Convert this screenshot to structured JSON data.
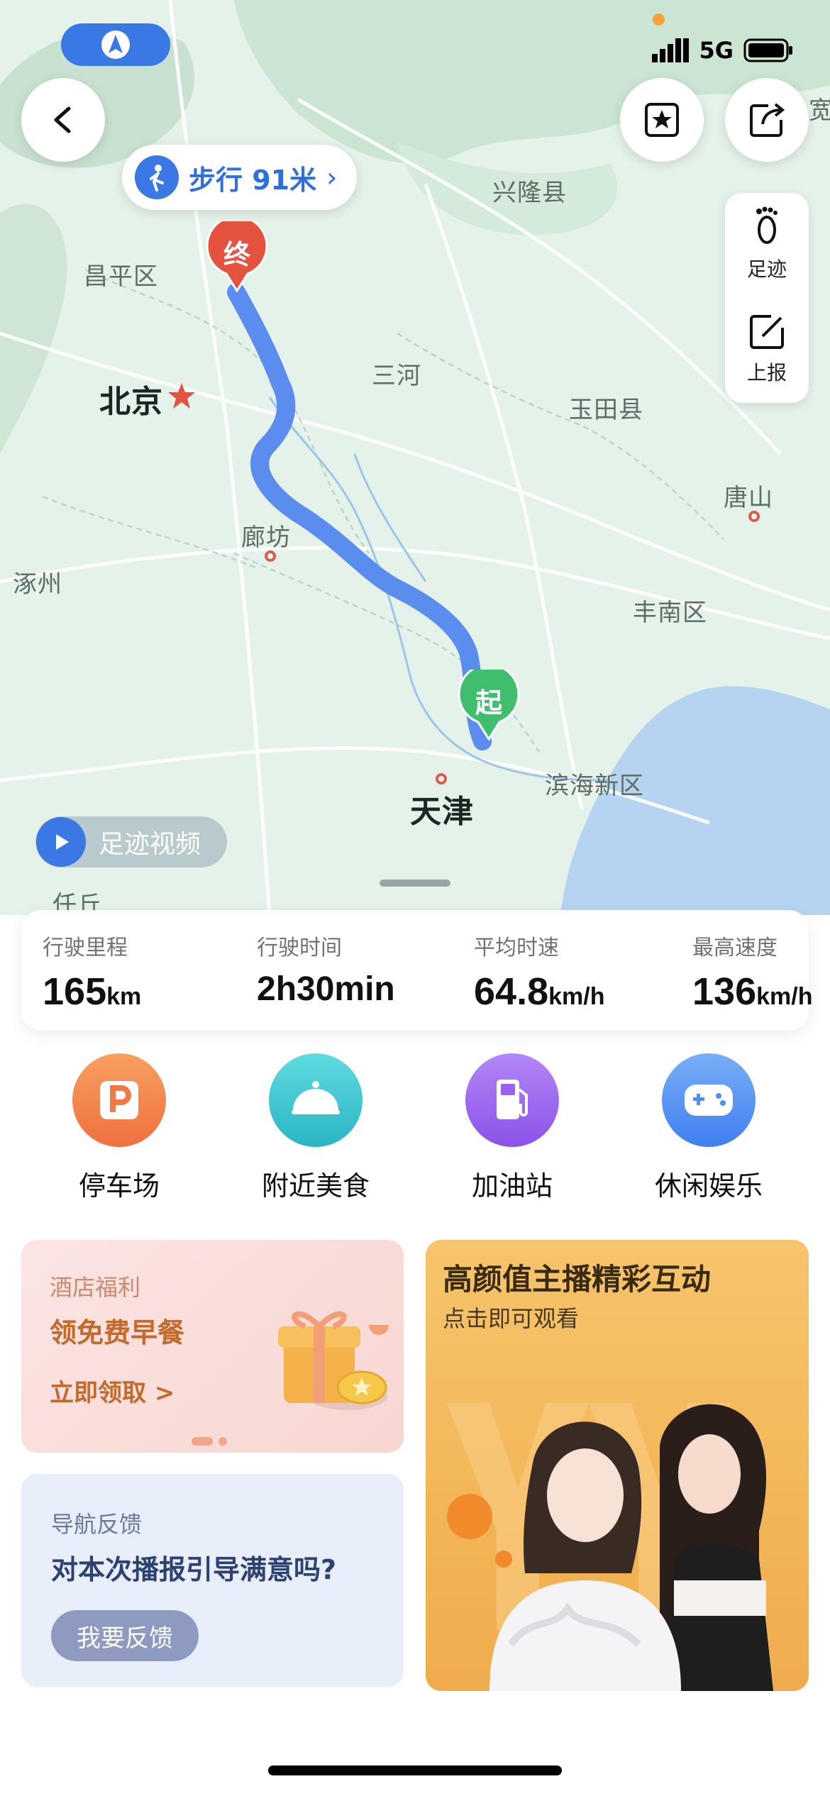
{
  "status_bar": {
    "network": "5G"
  },
  "map": {
    "walk_chip": "步行 91米",
    "end_marker": "终",
    "start_marker": "起",
    "cities": {
      "changping": "昌平区",
      "xinglong": "兴隆县",
      "beijing": "北京",
      "sanhe": "三河",
      "yutian": "玉田县",
      "tangshan": "唐山",
      "langfang": "廊坊",
      "zhuozhou": "涿州",
      "fengnan": "丰南区",
      "binhai": "滨海新区",
      "tianjin": "天津",
      "renqiu": "任丘",
      "edge": "宽"
    },
    "side_panel": {
      "footprint_label": "足迹",
      "report_label": "上报"
    },
    "video_chip": "足迹视频"
  },
  "stats": [
    {
      "label": "行驶里程",
      "value": "165",
      "unit": "km"
    },
    {
      "label": "行驶时间",
      "value": "2h30min"
    },
    {
      "label": "平均时速",
      "value": "64.8",
      "unit": "km/h"
    },
    {
      "label": "最高速度",
      "value": "136",
      "unit": "km/h"
    }
  ],
  "quick_actions": [
    {
      "label": "停车场",
      "icon": "parking-icon",
      "color": "#f47f4a"
    },
    {
      "label": "附近美食",
      "icon": "food-icon",
      "color": "#35c2cc"
    },
    {
      "label": "加油站",
      "icon": "gas-station-icon",
      "color": "#9a62ee"
    },
    {
      "label": "休闲娱乐",
      "icon": "gamepad-icon",
      "color": "#4f8ff2"
    }
  ],
  "hotel_card": {
    "tag": "酒店福利",
    "title": "领免费早餐",
    "cta": "立即领取 >"
  },
  "feedback_card": {
    "tag": "导航反馈",
    "question": "对本次播报引导满意吗?",
    "button": "我要反馈"
  },
  "live_card": {
    "title": "高颜值主播精彩互动",
    "subtitle": "点击即可观看"
  },
  "colors": {
    "route": "#5b8def",
    "accent": "#3a78e6",
    "end": "#e5523f",
    "start": "#3fbf6e"
  }
}
